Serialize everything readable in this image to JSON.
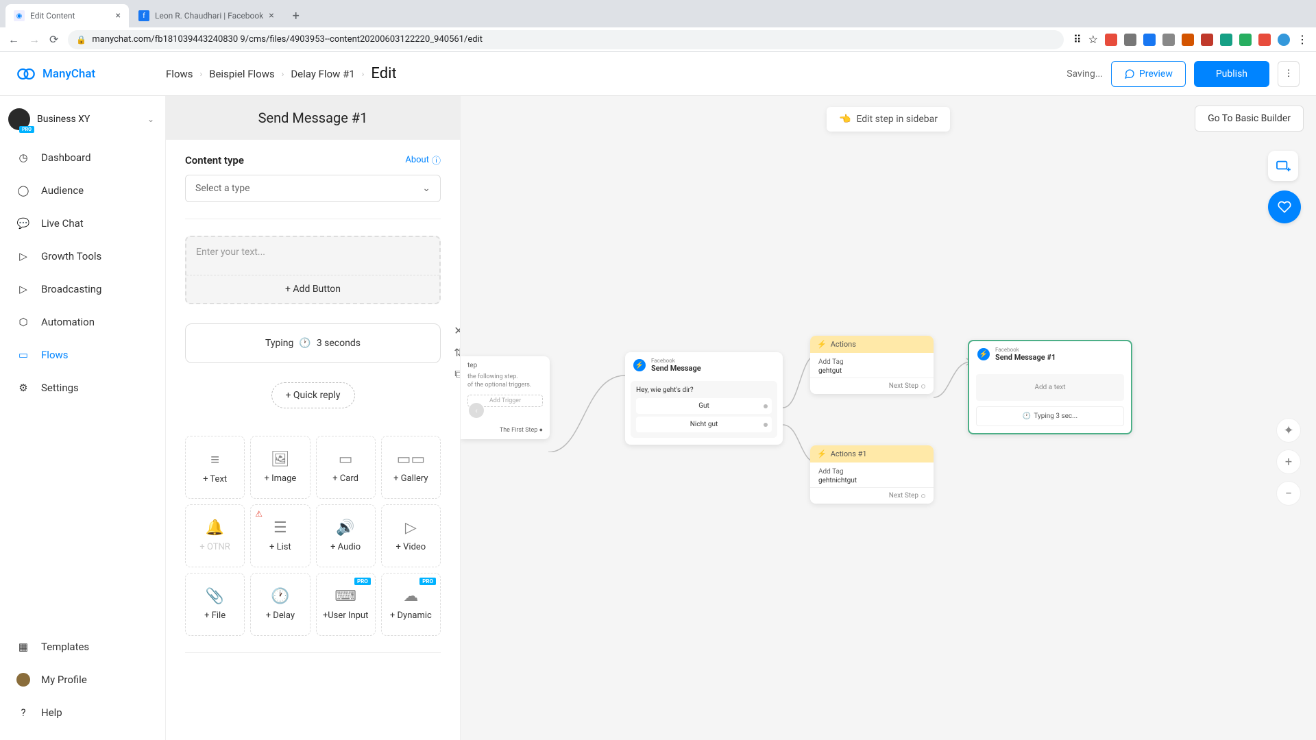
{
  "browser": {
    "tabs": [
      {
        "title": "Edit Content",
        "active": true
      },
      {
        "title": "Leon R. Chaudhari | Facebook",
        "active": false
      }
    ],
    "url": "manychat.com/fb181039443240830 9/cms/files/4903953--content20200603122220_940561/edit"
  },
  "app": {
    "brand": "ManyChat",
    "breadcrumb": [
      "Flows",
      "Beispiel Flows",
      "Delay Flow #1"
    ],
    "breadcrumb_current": "Edit",
    "saving": "Saving...",
    "preview": "Preview",
    "publish": "Publish"
  },
  "workspace": {
    "name": "Business XY",
    "badge": "PRO"
  },
  "sidebar": {
    "items": [
      "Dashboard",
      "Audience",
      "Live Chat",
      "Growth Tools",
      "Broadcasting",
      "Automation",
      "Flows",
      "Settings"
    ],
    "bottom": [
      "Templates",
      "My Profile",
      "Help"
    ]
  },
  "panel": {
    "title": "Send Message #1",
    "content_type_label": "Content type",
    "about": "About",
    "select_placeholder": "Select a type",
    "text_placeholder": "Enter your text...",
    "add_button": "+ Add Button",
    "typing_label": "Typing",
    "typing_duration": "3 seconds",
    "quick_reply": "+ Quick reply",
    "tiles": [
      {
        "label": "+ Text",
        "icon": "lines"
      },
      {
        "label": "+ Image",
        "icon": "image"
      },
      {
        "label": "+ Card",
        "icon": "card"
      },
      {
        "label": "+ Gallery",
        "icon": "gallery"
      },
      {
        "label": "+ OTNR",
        "icon": "bell",
        "disabled": true
      },
      {
        "label": "+ List",
        "icon": "list",
        "warn": true
      },
      {
        "label": "+ Audio",
        "icon": "audio"
      },
      {
        "label": "+ Video",
        "icon": "video"
      },
      {
        "label": "+ File",
        "icon": "file"
      },
      {
        "label": "+ Delay",
        "icon": "clock"
      },
      {
        "label": "+User Input",
        "icon": "input",
        "pro": true
      },
      {
        "label": "+ Dynamic",
        "icon": "dynamic",
        "pro": true
      }
    ]
  },
  "canvas": {
    "toast": "Edit step in sidebar",
    "basic_builder": "Go To Basic Builder",
    "partial": {
      "title_suffix": "tep",
      "hint1": "the following step.",
      "hint2": "of the optional triggers.",
      "add_trigger": "Add Trigger",
      "first_step": "The First Step"
    },
    "send_node": {
      "platform": "Facebook",
      "title": "Send Message",
      "question": "Hey, wie geht's dir?",
      "options": [
        "Gut",
        "Nicht gut"
      ]
    },
    "actions_node": {
      "title": "Actions",
      "add_tag": "Add Tag",
      "tag": "gehtgut",
      "next": "Next Step"
    },
    "actions2_node": {
      "title": "Actions #1",
      "add_tag": "Add Tag",
      "tag": "gehtnichtgut",
      "next": "Next Step"
    },
    "msg1_node": {
      "platform": "Facebook",
      "title": "Send Message #1",
      "placeholder": "Add a text",
      "typing": "Typing 3 sec..."
    }
  },
  "colors": {
    "primary": "#0084ff",
    "accent_yellow": "#ffe9a8",
    "selected_green": "#4caf87"
  }
}
